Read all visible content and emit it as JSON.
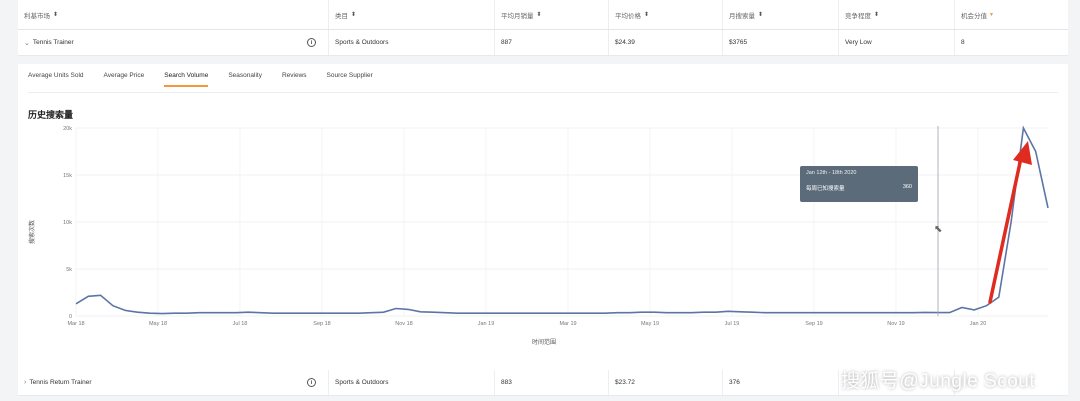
{
  "table": {
    "headers": [
      {
        "label": "利基市场",
        "sort": "⬍"
      },
      {
        "label": "类目",
        "sort": "⬍"
      },
      {
        "label": "平均月销量",
        "sort": "⬍"
      },
      {
        "label": "平均价格",
        "sort": "⬍"
      },
      {
        "label": "月搜索量",
        "sort": "⬍"
      },
      {
        "label": "竞争程度",
        "sort": "⬍"
      },
      {
        "label": "机会分值",
        "sort": "▾"
      }
    ],
    "rows": [
      {
        "name": "Tennis Trainer",
        "category": "Sports & Outdoors",
        "units": "887",
        "price": "$24.39",
        "search": "$3765",
        "competition": "Very Low",
        "score": "8"
      },
      {
        "name": "Tennis Return Trainer",
        "category": "Sports & Outdoors",
        "units": "883",
        "price": "$23.72",
        "search": "376",
        "competition": "",
        "score": ""
      }
    ],
    "info_icon": "i"
  },
  "panel": {
    "tabs": [
      "Average Units Sold",
      "Average Price",
      "Search Volume",
      "Seasonality",
      "Reviews",
      "Source Supplier"
    ],
    "active_tab": 2,
    "title": "历史搜索量",
    "y_label": "搜索次数",
    "x_label": "时间范围"
  },
  "tooltip": {
    "date": "Jan 12th - 18th 2020",
    "metric": "每周已知搜索量",
    "value": "360"
  },
  "watermark": "搜狐号@Jungle Scout",
  "colors": {
    "accent": "#f29a3a",
    "line": "#5d74a6",
    "arrow": "#e02b20",
    "tooltip": "#5b6b79"
  },
  "chart_data": {
    "type": "line",
    "title": "历史搜索量",
    "xlabel": "时间范围",
    "ylabel": "搜索次数",
    "y_ticks": [
      "0",
      "5k",
      "10k",
      "15k",
      "20k"
    ],
    "x_ticks": [
      "Mar 18",
      "May 18",
      "Jul 18",
      "Sep 18",
      "Nov 18",
      "Jan 19",
      "Mar 19",
      "May 19",
      "Jul 19",
      "Sep 19",
      "Nov 19",
      "Jan 20"
    ],
    "ylim": [
      0,
      20000
    ],
    "grid": true,
    "series": [
      {
        "values": [
          1300,
          2100,
          2200,
          1100,
          600,
          400,
          300,
          250,
          300,
          300,
          350,
          350,
          350,
          350,
          400,
          350,
          300,
          300,
          300,
          300,
          300,
          300,
          300,
          300,
          350,
          400,
          800,
          700,
          450,
          400,
          350,
          300,
          300,
          300,
          300,
          300,
          300,
          300,
          300,
          300,
          300,
          300,
          300,
          300,
          350,
          350,
          400,
          400,
          350,
          350,
          350,
          400,
          400,
          500,
          450,
          400,
          350,
          350,
          350,
          350,
          350,
          350,
          350,
          350,
          350,
          350,
          350,
          350,
          350,
          380,
          360,
          360,
          900,
          650,
          1100,
          2000,
          10000,
          20000,
          17500,
          11500
        ]
      }
    ]
  }
}
